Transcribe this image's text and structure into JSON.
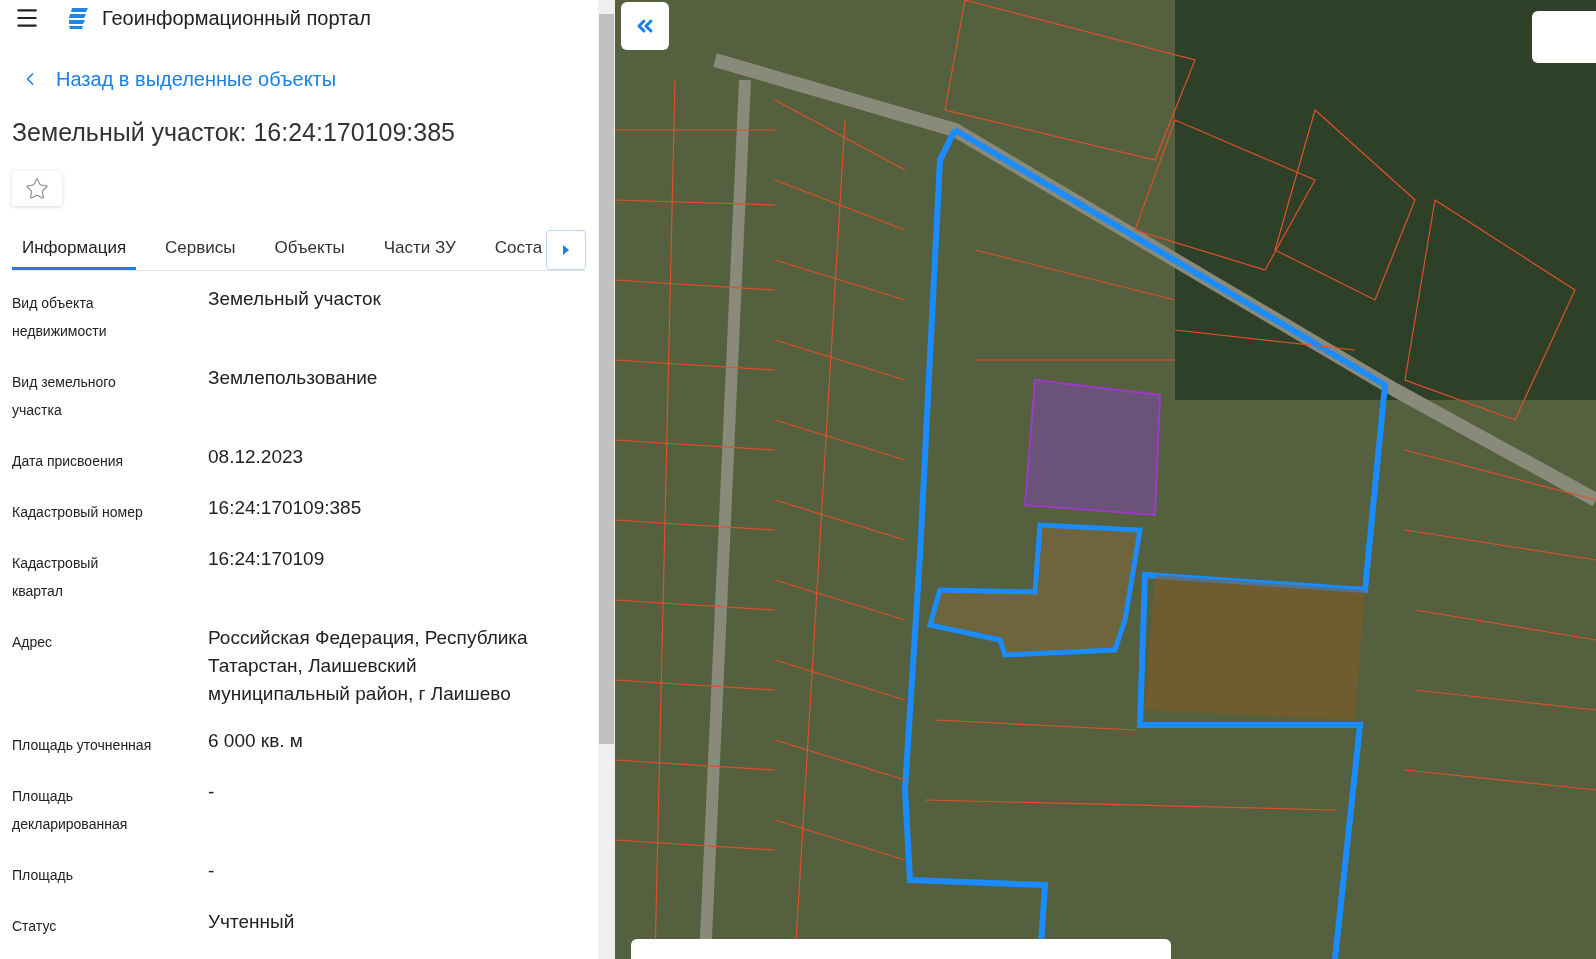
{
  "header": {
    "title": "Геоинформационный портал"
  },
  "back_link": {
    "label": "Назад в выделенные объекты"
  },
  "object_title": "Земельный участок: 16:24:170109:385",
  "favorite": {
    "checked": false
  },
  "tabs": [
    {
      "label": "Информация",
      "selected": true
    },
    {
      "label": "Сервисы",
      "selected": false
    },
    {
      "label": "Объекты",
      "selected": false
    },
    {
      "label": "Части ЗУ",
      "selected": false
    },
    {
      "label": "Соста",
      "selected": false
    }
  ],
  "fields": [
    {
      "label": "Вид объекта недвижимости",
      "value": "Земельный участок"
    },
    {
      "label": "Вид земельного участка",
      "value": "Землепользование"
    },
    {
      "label": "Дата присвоения",
      "value": "08.12.2023"
    },
    {
      "label": "Кадастровый номер",
      "value": "16:24:170109:385"
    },
    {
      "label": "Кадастровый квартал",
      "value": "16:24:170109"
    },
    {
      "label": "Адрес",
      "value": "Российская Федерация, Республика Татарстан, Лаишевский муниципальный район, г Лаишево"
    },
    {
      "label": "Площадь уточненная",
      "value": "6 000 кв. м"
    },
    {
      "label": "Площадь декларированная",
      "value": "-"
    },
    {
      "label": "Площадь",
      "value": "-"
    },
    {
      "label": "Статус",
      "value": "Учтенный"
    }
  ]
}
